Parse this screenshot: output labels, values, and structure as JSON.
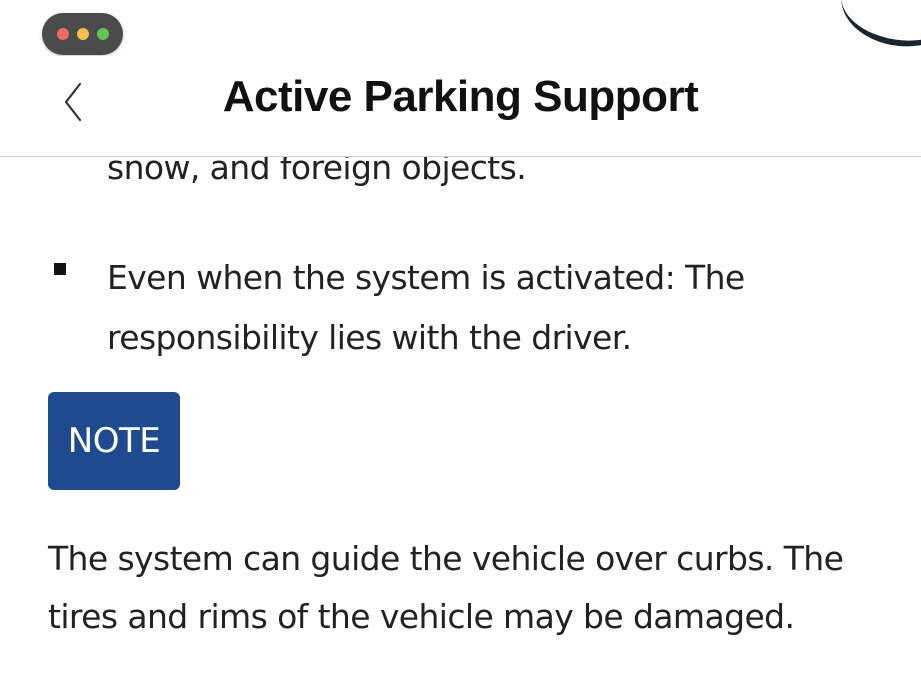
{
  "window": {
    "controls": [
      "close",
      "minimize",
      "maximize"
    ]
  },
  "header": {
    "title": "Active Parking Support",
    "back_icon": "chevron-left-icon"
  },
  "content": {
    "partial_text": "snow, and foreign objects.",
    "bullets": [
      {
        "text": "Even when the system is activated: The responsibility lies with the driver."
      }
    ],
    "note": {
      "label": "NOTE",
      "text": "The system can guide the vehicle over curbs. The tires and rims of the vehicle may be damaged."
    }
  },
  "colors": {
    "note_badge": "#1f4a8f",
    "text": "#222222",
    "divider": "#cfcfcf"
  }
}
